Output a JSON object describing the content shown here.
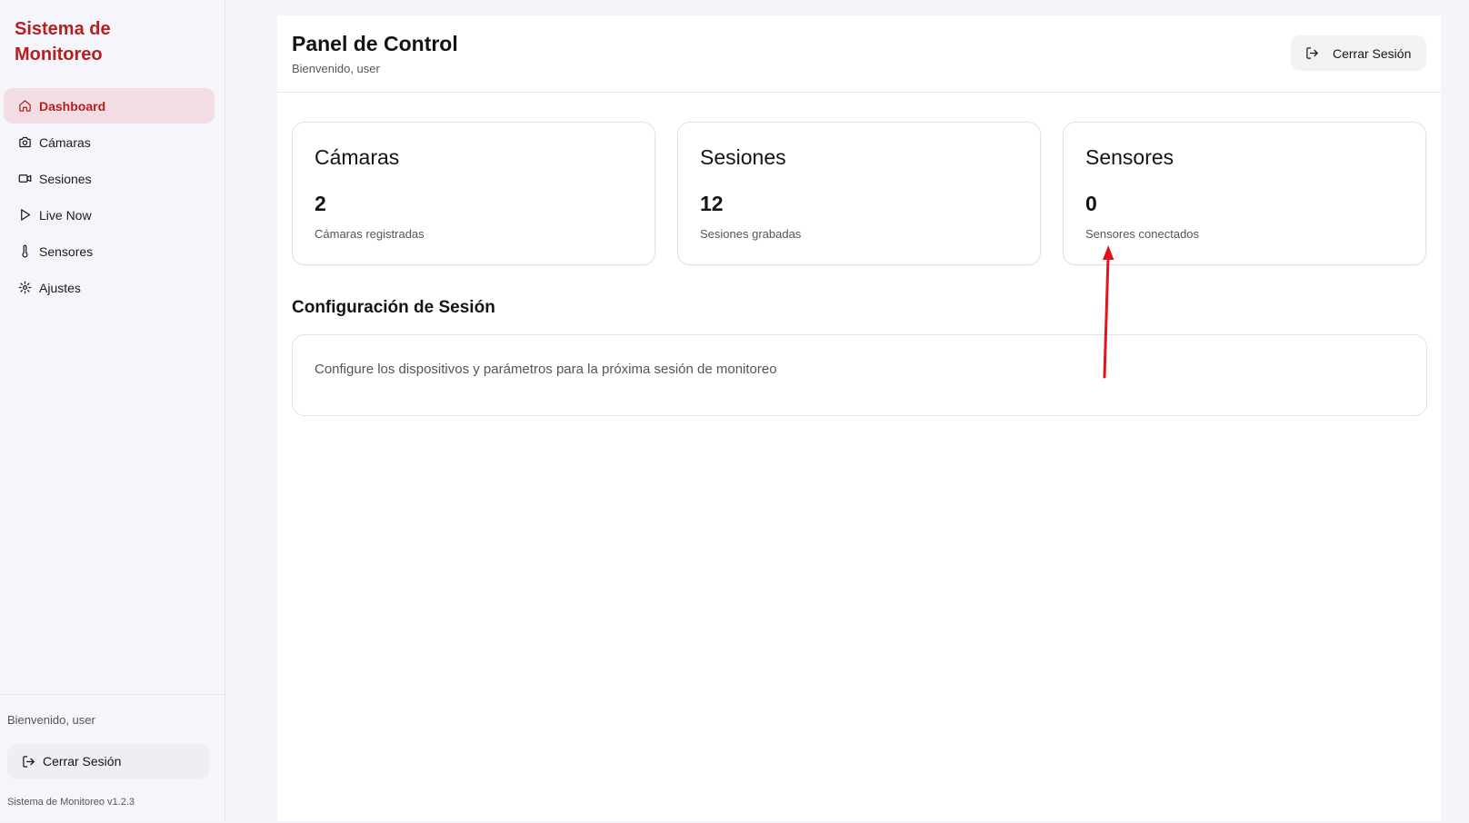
{
  "app": {
    "brand": "Sistema de Monitoreo",
    "accent_color": "#b5201f"
  },
  "sidebar": {
    "items": [
      {
        "label": "Dashboard",
        "icon": "home-icon",
        "active": true
      },
      {
        "label": "Cámaras",
        "icon": "camera-icon"
      },
      {
        "label": "Sesiones",
        "icon": "video-icon"
      },
      {
        "label": "Live Now",
        "icon": "play-icon"
      },
      {
        "label": "Sensores",
        "icon": "thermometer-icon"
      },
      {
        "label": "Ajustes",
        "icon": "gear-icon"
      }
    ],
    "welcome": "Bienvenido, user",
    "logout_label": "Cerrar Sesión",
    "version": "Sistema de Monitoreo v1.2.3"
  },
  "header": {
    "title": "Panel de Control",
    "subtitle": "Bienvenido, user",
    "logout_label": "Cerrar Sesión"
  },
  "cards": [
    {
      "title": "Cámaras",
      "value": "2",
      "description": "Cámaras registradas"
    },
    {
      "title": "Sesiones",
      "value": "12",
      "description": "Sesiones grabadas"
    },
    {
      "title": "Sensores",
      "value": "0",
      "description": "Sensores conectados"
    }
  ],
  "session_config": {
    "title": "Configuración de Sesión",
    "description": "Configure los dispositivos y parámetros para la próxima sesión de monitoreo"
  },
  "annotation": {
    "type": "arrow",
    "color": "#e3131b",
    "target": "Sensores conectados"
  }
}
